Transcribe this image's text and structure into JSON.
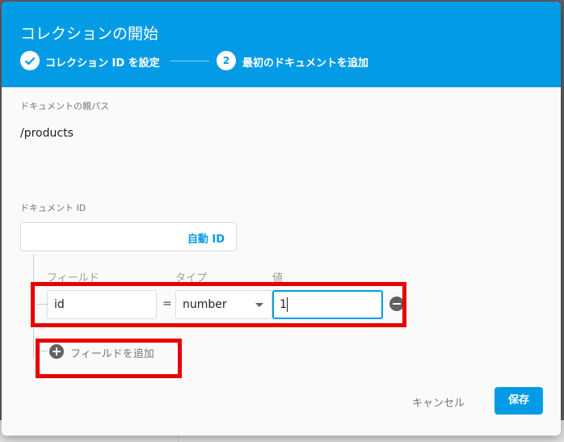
{
  "dialog": {
    "title": "コレクションの開始",
    "steps": [
      {
        "number": "✓",
        "label": "コレクション ID を設定",
        "state": "completed"
      },
      {
        "number": "2",
        "label": "最初のドキュメントを追加",
        "state": "active"
      }
    ],
    "parent_path_label": "ドキュメントの親パス",
    "parent_path_value": "/products",
    "document_id_label": "ドキュメント ID",
    "document_id_value": "",
    "auto_id_label": "自動 ID",
    "columns": {
      "field": "フィールド",
      "type": "タイプ",
      "value": "値"
    },
    "field_row": {
      "field": "id",
      "operator": "=",
      "type": "number",
      "value": "1"
    },
    "add_field_label": "フィールドを追加",
    "cancel_label": "キャンセル",
    "save_label": "保存"
  },
  "colors": {
    "accent": "#039be5",
    "highlight": "#e80000"
  },
  "icons": {
    "step1": "check-icon",
    "remove": "minus-circle-icon",
    "add": "plus-circle-icon",
    "dropdown": "caret-down-icon"
  }
}
